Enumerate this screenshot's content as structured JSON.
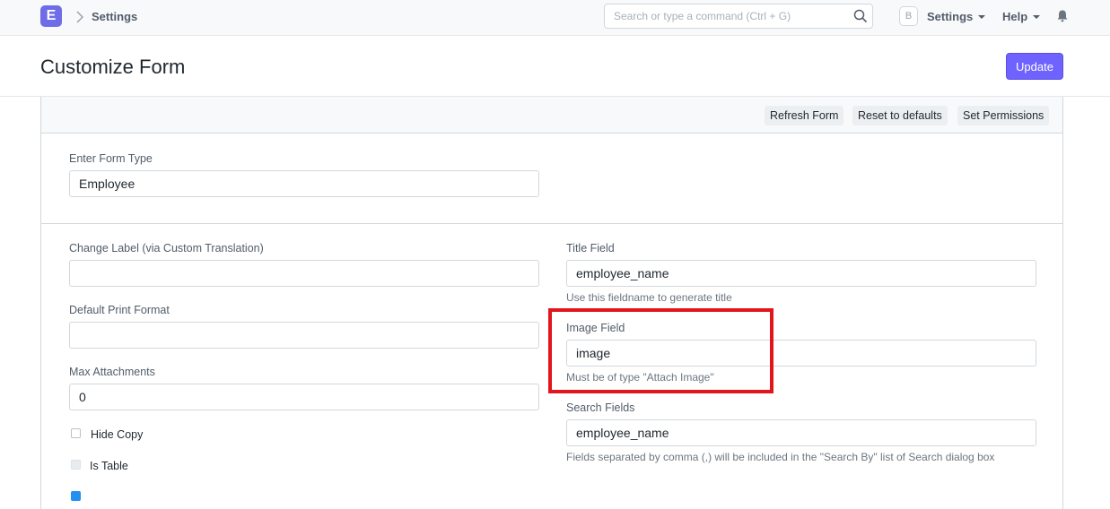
{
  "navbar": {
    "logo_letter": "E",
    "breadcrumb": "Settings",
    "search_placeholder": "Search or type a command (Ctrl + G)",
    "avatar_letter": "B",
    "settings_label": "Settings",
    "help_label": "Help",
    "icons": [
      "chevron-right-icon",
      "search-icon",
      "bell-icon"
    ]
  },
  "page": {
    "title": "Customize Form",
    "update_label": "Update"
  },
  "toolbar": {
    "refresh_label": "Refresh Form",
    "reset_label": "Reset to defaults",
    "permissions_label": "Set Permissions"
  },
  "form": {
    "form_type": {
      "label": "Enter Form Type",
      "value": "Employee"
    },
    "change_label": {
      "label": "Change Label (via Custom Translation)",
      "value": ""
    },
    "default_print_format": {
      "label": "Default Print Format",
      "value": ""
    },
    "max_attachments": {
      "label": "Max Attachments",
      "value": "0"
    },
    "hide_copy": {
      "label": "Hide Copy",
      "checked": false
    },
    "is_table": {
      "label": "Is Table",
      "checked": false,
      "disabled": true
    },
    "title_field": {
      "label": "Title Field",
      "value": "employee_name",
      "help": "Use this fieldname to generate title"
    },
    "image_field": {
      "label": "Image Field",
      "value": "image",
      "help": "Must be of type \"Attach Image\""
    },
    "search_fields": {
      "label": "Search Fields",
      "value": "employee_name",
      "help": "Fields separated by comma (,) will be included in the \"Search By\" list of Search dialog box"
    }
  },
  "colors": {
    "primary": "#6f63ff",
    "highlight": "#e3141b",
    "checkbox_checked": "#2490ef"
  }
}
